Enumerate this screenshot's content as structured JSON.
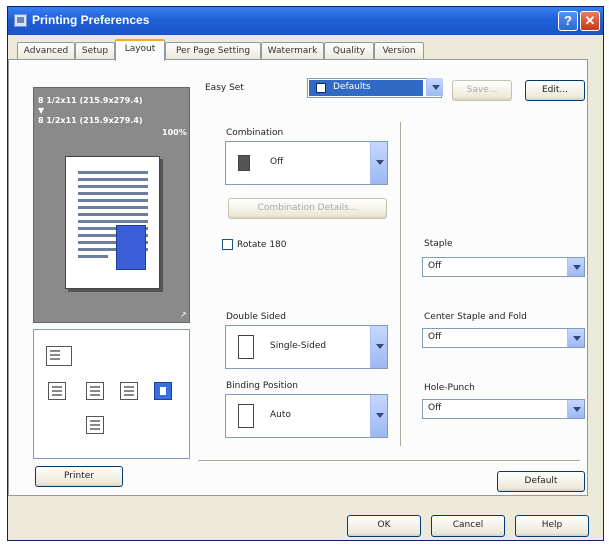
{
  "window": {
    "title": "Printing Preferences",
    "help_glyph": "?",
    "close_glyph": "✕"
  },
  "tabs": [
    {
      "label": "Advanced"
    },
    {
      "label": "Setup"
    },
    {
      "label": "Layout",
      "active": true
    },
    {
      "label": "Per Page Setting"
    },
    {
      "label": "Watermark"
    },
    {
      "label": "Quality"
    },
    {
      "label": "Version"
    }
  ],
  "preview": {
    "line1": "8 1/2x11 (215.9x279.4)",
    "line2": "▼",
    "line3": "8 1/2x11 (215.9x279.4)",
    "line4": "100%",
    "corner_mark": "↗"
  },
  "icon_panel": {
    "icons": [
      "printer-icon",
      "output-tray-icon",
      "finisher-icon",
      "mailbox-icon",
      "selected-option-icon",
      "options-icon"
    ]
  },
  "easy_set": {
    "label": "Easy Set",
    "value": "Defaults",
    "save_label": "Save...",
    "edit_label": "Edit..."
  },
  "combination": {
    "label": "Combination",
    "value": "Off",
    "details_label": "Combination Details..."
  },
  "rotate": {
    "label": "Rotate 180",
    "checked": false
  },
  "double_sided": {
    "label": "Double Sided",
    "value": "Single-Sided"
  },
  "binding_position": {
    "label": "Binding Position",
    "value": "Auto"
  },
  "staple": {
    "label": "Staple",
    "value": "Off"
  },
  "center_staple": {
    "label": "Center Staple and Fold",
    "value": "Off"
  },
  "hole_punch": {
    "label": "Hole-Punch",
    "value": "Off"
  },
  "buttons": {
    "printer": "Printer",
    "default": "Default",
    "ok": "OK",
    "cancel": "Cancel",
    "help": "Help"
  },
  "colors": {
    "title_bar": "#1e5fd6",
    "dialog_bg": "#ece9d8",
    "selection": "#316ac5"
  }
}
